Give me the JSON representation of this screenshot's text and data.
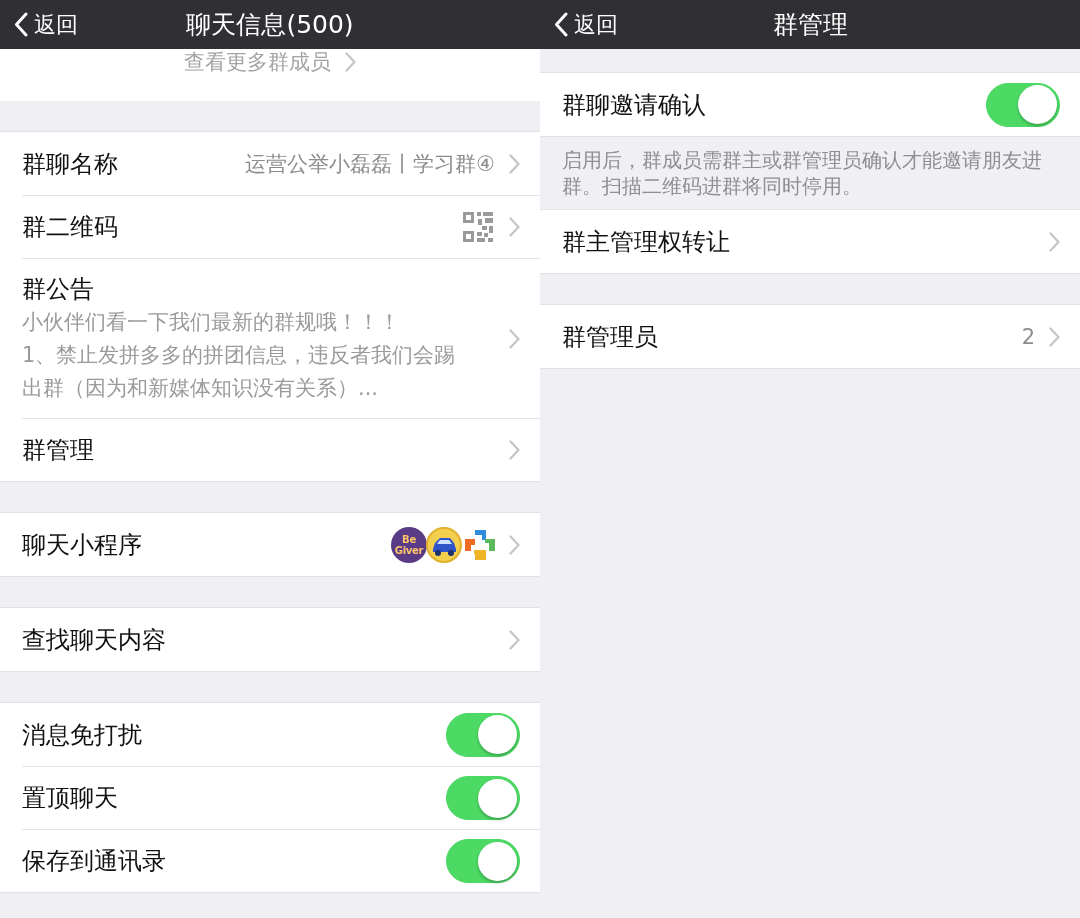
{
  "panels": [
    {
      "nav": {
        "back_label": "返回",
        "title": "聊天信息(500)"
      },
      "more_members": "查看更多群成员",
      "sections": [
        {
          "rows": [
            {
              "kind": "value",
              "label": "群聊名称",
              "value": "运营公举小磊磊丨学习群④"
            },
            {
              "kind": "qr",
              "label": "群二维码"
            },
            {
              "kind": "notice",
              "label": "群公告",
              "lines": [
                "小伙伴们看一下我们最新的群规哦！！！",
                "1、禁止发拼多多的拼团信息，违反者我们会踢",
                "出群（因为和新媒体知识没有关系）..."
              ]
            },
            {
              "kind": "link",
              "label": "群管理"
            }
          ]
        },
        {
          "rows": [
            {
              "kind": "apps",
              "label": "聊天小程序",
              "apps": [
                {
                  "kind": "wordmark",
                  "text": "Be Giver"
                },
                {
                  "kind": "car"
                },
                {
                  "kind": "cross"
                }
              ]
            }
          ]
        },
        {
          "rows": [
            {
              "kind": "link",
              "label": "查找聊天内容"
            }
          ]
        },
        {
          "rows": [
            {
              "kind": "toggle",
              "label": "消息免打扰",
              "on": true
            },
            {
              "kind": "toggle",
              "label": "置顶聊天",
              "on": true
            },
            {
              "kind": "toggle",
              "label": "保存到通讯录",
              "on": true
            }
          ]
        }
      ]
    },
    {
      "nav": {
        "back_label": "返回",
        "title": "群管理"
      },
      "sections": [
        {
          "rows": [
            {
              "kind": "toggle",
              "label": "群聊邀请确认",
              "on": true
            }
          ],
          "footer": "启用后，群成员需群主或群管理员确认才能邀请朋友进群。扫描二维码进群将同时停用。"
        },
        {
          "rows": [
            {
              "kind": "link",
              "label": "群主管理权转让"
            }
          ]
        },
        {
          "rows": [
            {
              "kind": "value",
              "label": "群管理员",
              "value": "2"
            }
          ]
        }
      ]
    }
  ]
}
